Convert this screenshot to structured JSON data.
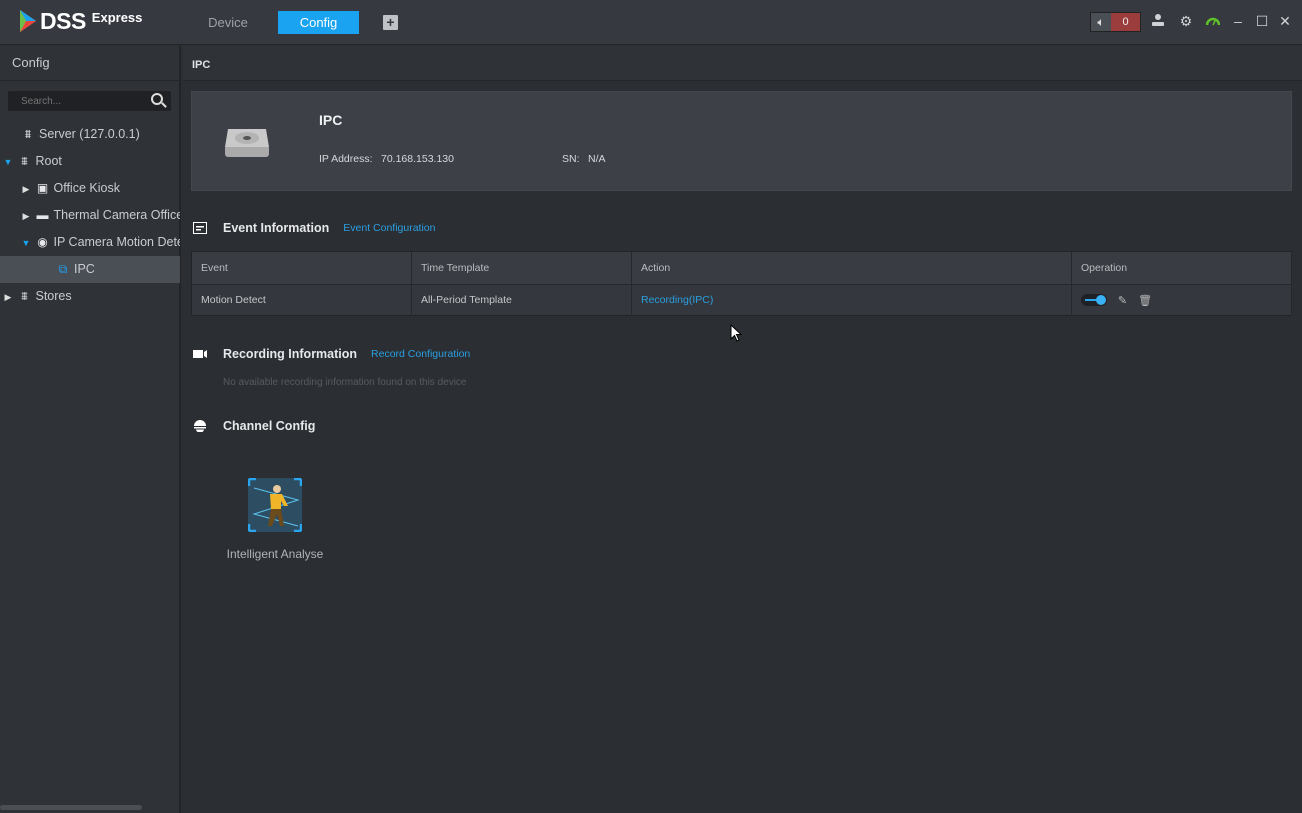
{
  "app": {
    "logo_main": "DSS",
    "logo_sub": "Express"
  },
  "tabs": [
    {
      "label": "Device"
    },
    {
      "label": "Config"
    }
  ],
  "topbar": {
    "alarm_count": "0",
    "icons": [
      "speaker-icon",
      "user-icon",
      "gear-icon",
      "performance-gauge-icon",
      "minimize-icon",
      "maximize-icon",
      "close-icon"
    ]
  },
  "sidebar": {
    "title": "Config",
    "search_placeholder": "Search...",
    "tree": [
      {
        "label": "Server (127.0.0.1)"
      },
      {
        "label": "Root"
      },
      {
        "label": "Office Kiosk"
      },
      {
        "label": "Thermal Camera Office"
      },
      {
        "label": "IP Camera Motion Detection"
      },
      {
        "label": "IPC"
      },
      {
        "label": "Stores"
      }
    ]
  },
  "main": {
    "breadcrumb": "IPC",
    "device": {
      "name": "IPC",
      "ip_label": "IP Address:",
      "ip": "70.168.153.130",
      "sn_label": "SN:",
      "sn": "N/A"
    },
    "event": {
      "title": "Event Information",
      "link": "Event Configuration",
      "columns": [
        "Event",
        "Time Template",
        "Action",
        "Operation"
      ],
      "rows": [
        {
          "event": "Motion Detect",
          "template": "All-Period Template",
          "action": "Recording(IPC)",
          "enabled": true
        }
      ]
    },
    "recording": {
      "title": "Recording Information",
      "link": "Record Configuration",
      "empty": "No available recording information found on this device"
    },
    "channel": {
      "title": "Channel Config",
      "items": [
        {
          "label": "Intelligent Analyse"
        }
      ]
    }
  },
  "colors": {
    "accent": "#1aa3f0",
    "alarm": "#9b3d3d",
    "gauge": "#5fc22a"
  }
}
